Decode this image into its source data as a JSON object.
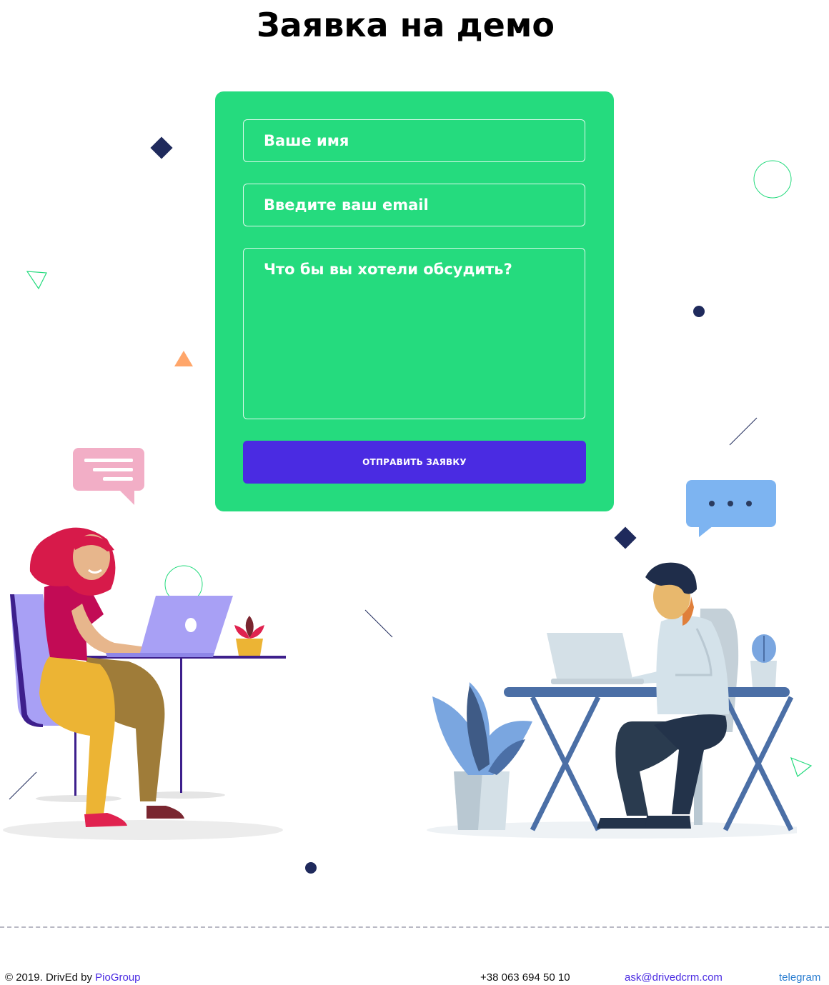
{
  "page": {
    "title": "Заявка на демо"
  },
  "form": {
    "name_placeholder": "Ваше имя",
    "email_placeholder": "Введите ваш email",
    "message_placeholder": "Что бы вы хотели обсудить?",
    "submit_label": "ОТПРАВИТЬ ЗАЯВКУ"
  },
  "footer": {
    "copyright": "© 2019.",
    "brand": "DrivEd by",
    "company_link": "PioGroup",
    "phone": "+38 063 694 50 10",
    "email": "ask@drivedcrm.com",
    "telegram": "telegram"
  },
  "colors": {
    "form_bg": "#25db7e",
    "button_bg": "#4a2be2",
    "link": "#4a2be2",
    "telegram_link": "#2d7fd1"
  },
  "icons": [
    "diamond-shape",
    "circle-outline",
    "triangle-outline",
    "triangle-filled",
    "dot",
    "line-slash",
    "chat-bubble-lines-icon",
    "chat-bubble-dots-icon"
  ]
}
